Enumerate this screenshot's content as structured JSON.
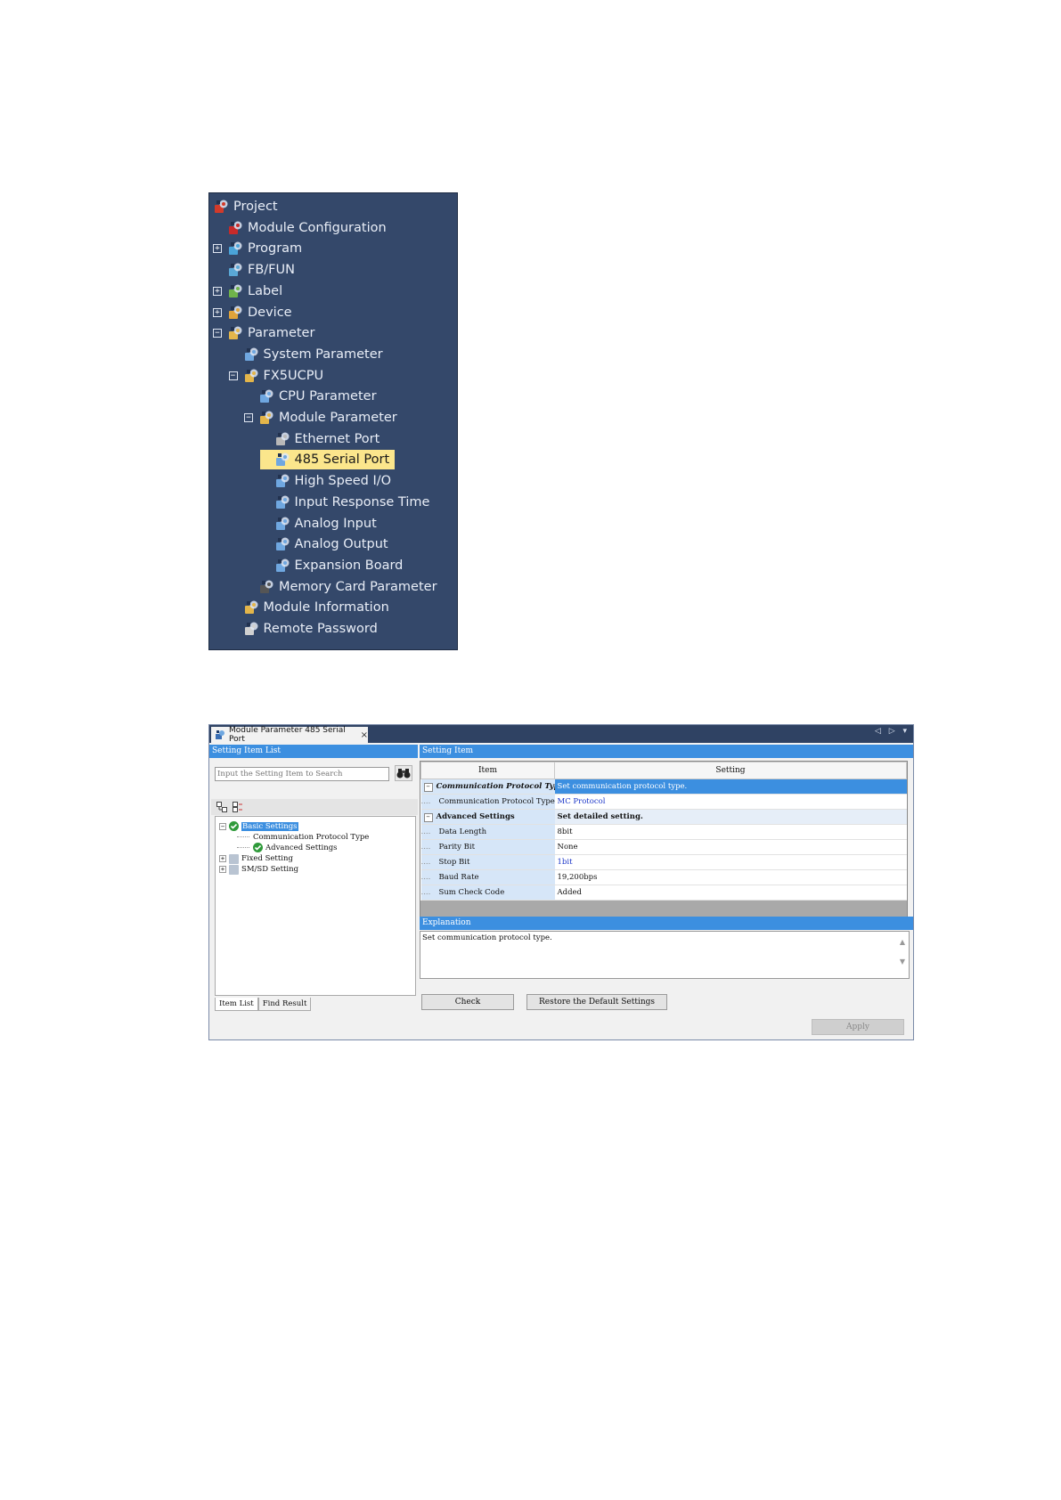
{
  "project_tree": {
    "items": [
      {
        "label": "Project",
        "level": 0,
        "expander": "none",
        "icon": "project-icon",
        "icon_color": "#d23a2a"
      },
      {
        "label": "Module Configuration",
        "level": 1,
        "expander": "none",
        "icon": "module-configuration-icon",
        "icon_color": "#c62a2a"
      },
      {
        "label": "Program",
        "level": 1,
        "expander": "plus",
        "icon": "program-icon",
        "icon_color": "#4aa3d8"
      },
      {
        "label": "FB/FUN",
        "level": 1,
        "expander": "none",
        "icon": "fb-fun-icon",
        "icon_color": "#5aa8d6"
      },
      {
        "label": "Label",
        "level": 1,
        "expander": "plus",
        "icon": "label-icon",
        "icon_color": "#6fb34a"
      },
      {
        "label": "Device",
        "level": 1,
        "expander": "plus",
        "icon": "device-icon",
        "icon_color": "#e0a33a"
      },
      {
        "label": "Parameter",
        "level": 1,
        "expander": "minus",
        "icon": "parameter-icon",
        "icon_color": "#e3b54a"
      },
      {
        "label": "System Parameter",
        "level": 2,
        "expander": "none",
        "icon": "parameter-item-icon",
        "icon_color": "#6fa7e0"
      },
      {
        "label": "FX5UCPU",
        "level": 2,
        "expander": "minus",
        "icon": "cpu-folder-icon",
        "icon_color": "#e3b54a"
      },
      {
        "label": "CPU Parameter",
        "level": 3,
        "expander": "none",
        "icon": "parameter-item-icon",
        "icon_color": "#6fa7e0"
      },
      {
        "label": "Module Parameter",
        "level": 3,
        "expander": "minus",
        "icon": "module-parameter-icon",
        "icon_color": "#e3b54a"
      },
      {
        "label": "Ethernet Port",
        "level": 4,
        "expander": "none",
        "icon": "ethernet-icon",
        "icon_color": "#b8b8b8"
      },
      {
        "label": "485 Serial Port",
        "level": 4,
        "expander": "none",
        "icon": "parameter-item-icon",
        "icon_color": "#6fa7e0",
        "selected": true
      },
      {
        "label": "High Speed I/O",
        "level": 4,
        "expander": "none",
        "icon": "parameter-item-icon",
        "icon_color": "#6fa7e0"
      },
      {
        "label": "Input Response Time",
        "level": 4,
        "expander": "none",
        "icon": "parameter-item-icon",
        "icon_color": "#6fa7e0"
      },
      {
        "label": "Analog Input",
        "level": 4,
        "expander": "none",
        "icon": "parameter-item-icon",
        "icon_color": "#6fa7e0"
      },
      {
        "label": "Analog Output",
        "level": 4,
        "expander": "none",
        "icon": "parameter-item-icon",
        "icon_color": "#6fa7e0"
      },
      {
        "label": "Expansion Board",
        "level": 4,
        "expander": "none",
        "icon": "parameter-item-icon",
        "icon_color": "#6fa7e0"
      },
      {
        "label": "Memory Card Parameter",
        "level": 3,
        "expander": "none",
        "icon": "memory-card-icon",
        "icon_color": "#555555"
      },
      {
        "label": "Module Information",
        "level": 2,
        "expander": "none",
        "icon": "module-information-icon",
        "icon_color": "#e3b54a"
      },
      {
        "label": "Remote Password",
        "level": 2,
        "expander": "none",
        "icon": "remote-password-icon",
        "icon_color": "#d0d0d0"
      }
    ]
  },
  "window": {
    "tab_label": "Module Parameter 485 Serial Port",
    "close_glyph": "×",
    "nav_glyphs": "◁ ▷ ▾",
    "left_panel": {
      "header": "Setting Item List",
      "search_placeholder": "Input the Setting Item to Search",
      "tree": [
        {
          "label": "Basic Settings",
          "level": 0,
          "expander": "−",
          "check": true,
          "selected": true
        },
        {
          "label": "Communication Protocol Type",
          "level": 1,
          "expander": "",
          "check": false
        },
        {
          "label": "Advanced Settings",
          "level": 1,
          "expander": "",
          "check": true
        },
        {
          "label": "Fixed Setting",
          "level": 0,
          "expander": "+",
          "check": false,
          "folder": true
        },
        {
          "label": "SM/SD Setting",
          "level": 0,
          "expander": "+",
          "check": false,
          "folder": true
        }
      ],
      "tabs": [
        "Item List",
        "Find Result"
      ]
    },
    "right_panel": {
      "header": "Setting Item",
      "columns": [
        "Item",
        "Setting"
      ],
      "rows": [
        {
          "type": "category",
          "item": "Communication Protocol Type",
          "setting": "Set communication protocol type."
        },
        {
          "type": "value",
          "item": "Communication Protocol Type",
          "setting": "MC Protocol",
          "blue": true
        },
        {
          "type": "category",
          "item": "Advanced Settings",
          "setting": "Set detailed setting."
        },
        {
          "type": "value",
          "item": "Data Length",
          "setting": "8bit",
          "blue": false
        },
        {
          "type": "value",
          "item": "Parity Bit",
          "setting": "None",
          "blue": false
        },
        {
          "type": "value",
          "item": "Stop Bit",
          "setting": "1bit",
          "blue": true
        },
        {
          "type": "value",
          "item": "Baud Rate",
          "setting": "19,200bps",
          "blue": false
        },
        {
          "type": "value",
          "item": "Sum Check Code",
          "setting": "Added",
          "blue": false
        }
      ],
      "explanation_header": "Explanation",
      "explanation_text": "Set communication protocol type.",
      "check_button": "Check",
      "restore_button": "Restore the Default Settings",
      "apply_button": "Apply"
    }
  },
  "colors": {
    "tree_background": "#34486a",
    "selection": "#fbe68c",
    "header_blue": "#3c8fe0",
    "setting_blue_text": "#1a35c8"
  }
}
